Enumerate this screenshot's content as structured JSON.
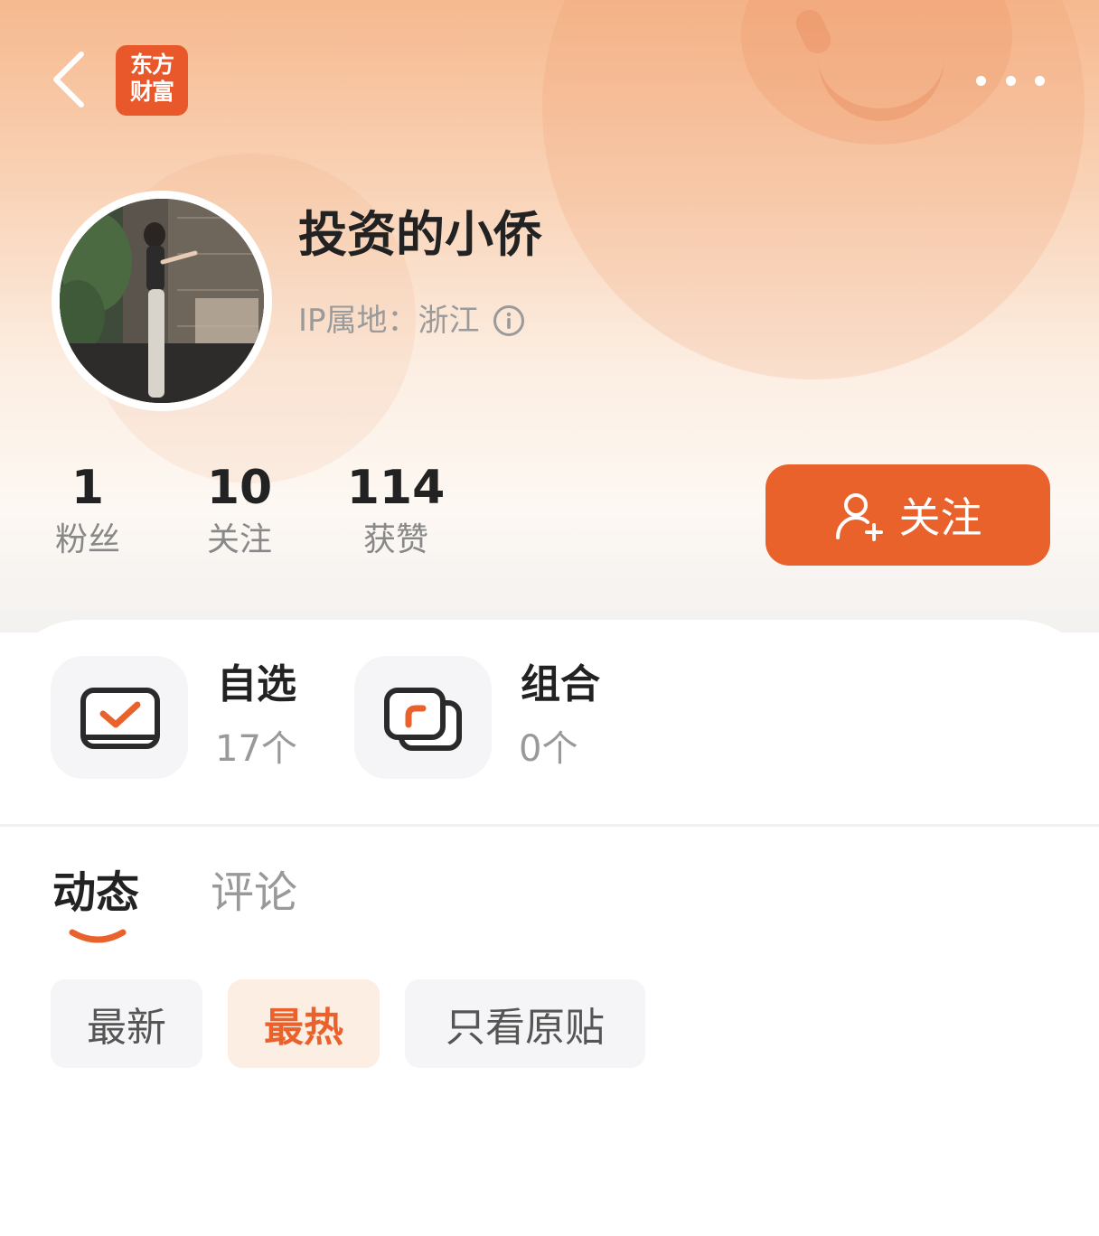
{
  "colors": {
    "accent": "#e9622c",
    "logo_bg": "#e8582a"
  },
  "header": {
    "logo_line1": "东方",
    "logo_line2": "财富",
    "back_icon": "chevron-left-icon",
    "more_icon": "more-dots-icon"
  },
  "profile": {
    "username": "投资的小侨",
    "ip_label": "IP属地：浙江",
    "info_icon": "info-icon",
    "avatar_icon": "avatar"
  },
  "stats": [
    {
      "value": "1",
      "label": "粉丝"
    },
    {
      "value": "10",
      "label": "关注"
    },
    {
      "value": "114",
      "label": "获赞"
    }
  ],
  "follow_button": {
    "label": "关注",
    "icon": "add-user-icon"
  },
  "tiles": [
    {
      "title": "自选",
      "count": "17个",
      "icon": "checkbox-icon"
    },
    {
      "title": "组合",
      "count": "0个",
      "icon": "portfolio-icon"
    }
  ],
  "tabs": [
    {
      "label": "动态",
      "active": true
    },
    {
      "label": "评论",
      "active": false
    }
  ],
  "filters": [
    {
      "label": "最新",
      "active": false
    },
    {
      "label": "最热",
      "active": true
    },
    {
      "label": "只看原贴",
      "active": false
    }
  ]
}
